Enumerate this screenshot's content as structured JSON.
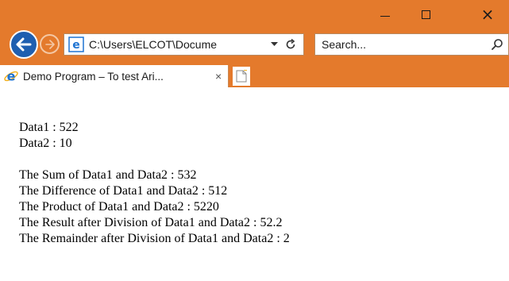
{
  "window": {
    "controls": {
      "minimize": "minimize",
      "maximize": "maximize",
      "close": "×"
    }
  },
  "toolbar": {
    "address_value": "C:\\Users\\ELCOT\\Docume",
    "search_placeholder": "Search..."
  },
  "tabs": [
    {
      "title": "Demo Program – To test Ari...",
      "close": "×"
    }
  ],
  "colors": {
    "chrome": "#e47a2c",
    "back_button": "#1f5fb0",
    "ie_blue": "#1e73d2"
  },
  "icons": {
    "back": "back-arrow-icon",
    "forward": "forward-arrow-icon",
    "page": "ie-logo-icon",
    "dropdown": "chevron-down-icon",
    "refresh": "refresh-icon",
    "search": "search-icon",
    "new_tab": "new-tab-icon"
  },
  "page": {
    "data_lines": [
      "Data1 : 522",
      "Data2 : 10"
    ],
    "result_lines": [
      "The Sum of Data1 and Data2 : 532",
      "The Difference of Data1 and Data2 : 512",
      "The Product of Data1 and Data2 : 5220",
      "The Result after Division of Data1 and Data2 : 52.2",
      "The Remainder after Division of Data1 and Data2 : 2"
    ]
  }
}
